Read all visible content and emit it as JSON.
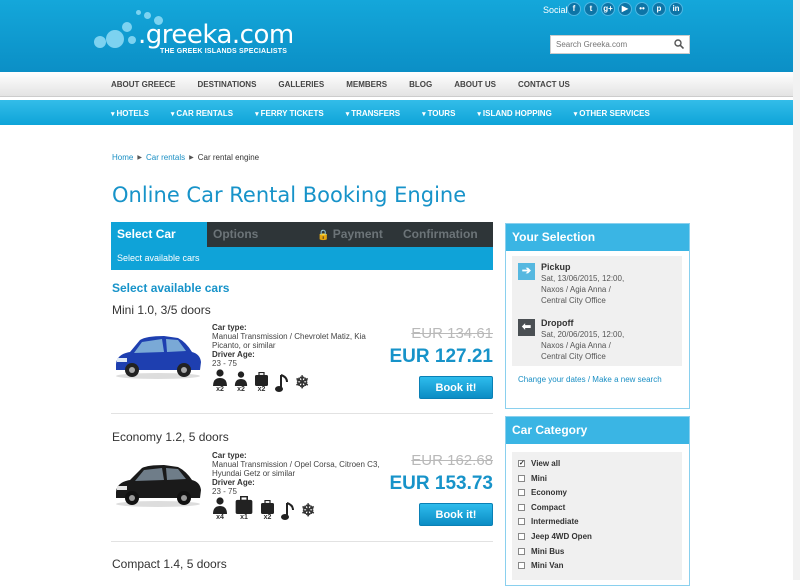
{
  "header": {
    "logo_text": ".greeka.com",
    "tagline": "THE GREEK ISLANDS SPECIALISTS",
    "social_label": "Social",
    "social_icons": [
      "facebook-icon",
      "twitter-icon",
      "googleplus-icon",
      "youtube-icon",
      "flickr-icon",
      "pinterest-icon",
      "linkedin-icon"
    ],
    "social_glyphs": [
      "f",
      "t",
      "g+",
      "▶",
      "••",
      "p",
      "in"
    ],
    "search_placeholder": "Search Greeka.com"
  },
  "mainnav": [
    "ABOUT GREECE",
    "DESTINATIONS",
    "GALLERIES",
    "MEMBERS",
    "BLOG",
    "ABOUT US",
    "CONTACT US"
  ],
  "subnav": [
    "HOTELS",
    "CAR RENTALS",
    "FERRY TICKETS",
    "TRANSFERS",
    "TOURS",
    "ISLAND HOPPING",
    "OTHER SERVICES"
  ],
  "breadcrumb": [
    "Home",
    "Car rentals",
    "Car rental engine"
  ],
  "page_title": "Online Car Rental Booking Engine",
  "steps": [
    "Select Car",
    "Options",
    "Payment",
    "Confirmation"
  ],
  "step_subtitle": "Select available cars",
  "section_heading": "Select available cars",
  "cars": [
    {
      "title": "Mini 1.0, 3/5 doors",
      "car_type_label": "Car type:",
      "car_type": "Manual Transmission / Chevrolet Matiz, Kia Picanto, or similar",
      "age_label": "Driver Age:",
      "age": "23 - 75",
      "old_price": "EUR 134.61",
      "price": "EUR 127.21",
      "book": "Book it!",
      "color": "#1e3fb0",
      "counts": [
        "x2",
        "x2",
        "x2"
      ]
    },
    {
      "title": "Economy 1.2, 5 doors",
      "car_type_label": "Car type:",
      "car_type": "Manual Transmission / Opel Corsa, Citroen C3, Hyundai Getz or similar",
      "age_label": "Driver Age:",
      "age": "23 - 75",
      "old_price": "EUR 162.68",
      "price": "EUR 153.73",
      "book": "Book it!",
      "color": "#1a1a1a",
      "counts": [
        "x4",
        "x1",
        "x2"
      ]
    },
    {
      "title": "Compact 1.4, 5 doors"
    }
  ],
  "selection": {
    "title": "Your Selection",
    "pickup_label": "Pickup",
    "pickup_lines": [
      "Sat, 13/06/2015, 12:00,",
      "Naxos / Agia Anna /",
      "Central City Office"
    ],
    "dropoff_label": "Dropoff",
    "dropoff_lines": [
      "Sat, 20/06/2015, 12:00,",
      "Naxos / Agia Anna /",
      "Central City Office"
    ],
    "change_dates": "Change your dates",
    "separator": " / ",
    "new_search": "Make a new search"
  },
  "category": {
    "title": "Car Category",
    "items": [
      "View all",
      "Mini",
      "Economy",
      "Compact",
      "Intermediate",
      "Jeep 4WD Open",
      "Mini Bus",
      "Mini Van"
    ],
    "checked": [
      true,
      false,
      false,
      false,
      false,
      false,
      false,
      false
    ]
  }
}
